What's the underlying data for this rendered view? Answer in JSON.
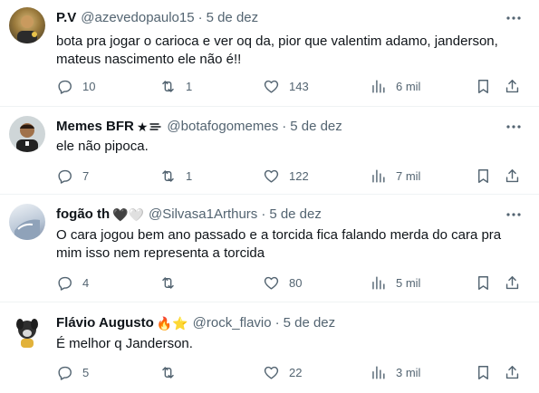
{
  "tweets": [
    {
      "name": "P.V",
      "badges": "",
      "handle": "@azevedopaulo15",
      "date": "5 de dez",
      "text_lines": [
        "bota pra jogar o carioca e ver oq da, pior que valentim adamo, janderson,",
        "mateus nascimento ele não é!!"
      ],
      "replies": "10",
      "reposts": "1",
      "likes": "143",
      "views": "6 mil"
    },
    {
      "name": "Memes BFR",
      "badges": "★",
      "handle": "@botafogomemes",
      "date": "5 de dez",
      "text_lines": [
        "ele não pipoca."
      ],
      "replies": "7",
      "reposts": "1",
      "likes": "122",
      "views": "7 mil"
    },
    {
      "name": "fogão th",
      "badges": "🖤🤍",
      "handle": "@Silvasa1Arthurs",
      "date": "5 de dez",
      "text_lines": [
        "O cara jogou bem ano passado e a torcida fica falando merda do cara pra",
        "mim isso nem representa a torcida"
      ],
      "replies": "4",
      "reposts": "",
      "likes": "80",
      "views": "5 mil"
    },
    {
      "name": "Flávio Augusto",
      "badges": "🔥⭐",
      "handle": "@rock_flavio",
      "date": "5 de dez",
      "text_lines": [
        "É melhor q Janderson."
      ],
      "replies": "5",
      "reposts": "",
      "likes": "22",
      "views": "3 mil"
    }
  ],
  "separator": "·",
  "colors": {
    "text": "#0f1419",
    "secondary": "#536471",
    "divider": "#eff3f4"
  },
  "icons": [
    "reply-icon",
    "retweet-icon",
    "like-icon",
    "views-icon",
    "bookmark-icon",
    "share-icon",
    "more-icon"
  ]
}
